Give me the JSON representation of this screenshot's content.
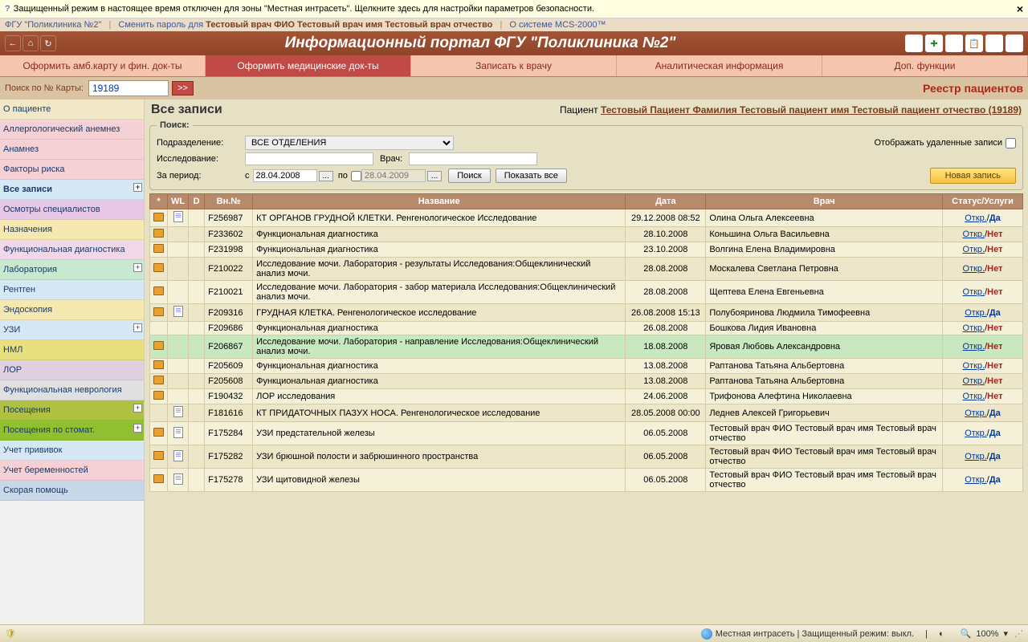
{
  "security": {
    "text": "Защищенный режим в настоящее время отключен для зоны \"Местная интрасеть\".  Щелкните здесь для настройки параметров безопасности.",
    "close": "×"
  },
  "toplinks": {
    "org": "ФГУ \"Поликлиника №2\"",
    "change_pw": "Сменить пароль для ",
    "user": "Тестовый врач ФИО Тестовый врач имя Тестовый врач отчество",
    "about": "О системе MCS-2000™"
  },
  "title": "Информационный портал ФГУ \"Поликлиника №2\"",
  "tabs": [
    "Оформить амб.карту и фин. док-ты",
    "Оформить медицинские док-ты",
    "Записать к врачу",
    "Аналитическая информация",
    "Доп. функции"
  ],
  "search": {
    "label": "Поиск по № Карты:",
    "value": "19189",
    "go": ">>",
    "registry": "Реестр пациентов"
  },
  "sidebar": [
    {
      "label": "О пациенте",
      "color": "#f2e8c8"
    },
    {
      "label": "Аллергологический анемнез",
      "color": "#f5d0d5"
    },
    {
      "label": "Анамнез",
      "color": "#f5d0d5"
    },
    {
      "label": "Факторы риска",
      "color": "#f5d0d5"
    },
    {
      "label": "Все записи",
      "color": "#d6e8f5",
      "plus": true,
      "active": true
    },
    {
      "label": "Осмотры специалистов",
      "color": "#e6c8e6"
    },
    {
      "label": "Назначения",
      "color": "#f5e8b0"
    },
    {
      "label": "Функциональная диагностика",
      "color": "#f0d8e8"
    },
    {
      "label": "Лаборатория",
      "color": "#c8e8d0",
      "plus": true
    },
    {
      "label": "Рентген",
      "color": "#d6e8f5"
    },
    {
      "label": "Эндоскопия",
      "color": "#f5e8b0"
    },
    {
      "label": "УЗИ",
      "color": "#d6e8f5",
      "plus": true
    },
    {
      "label": "НМЛ",
      "color": "#e8e080"
    },
    {
      "label": "ЛОР",
      "color": "#e0d0e0"
    },
    {
      "label": "Функциональная неврология",
      "color": "#e0e0e0"
    },
    {
      "label": "Посещения",
      "color": "#b0c040",
      "plus": true
    },
    {
      "label": "Посещения по стомат.",
      "color": "#90c030",
      "plus": true
    },
    {
      "label": "Учет прививок",
      "color": "#d6e8f5"
    },
    {
      "label": "Учет беременностей",
      "color": "#f5d0d5"
    },
    {
      "label": "Скорая помощь",
      "color": "#c8d8e8"
    }
  ],
  "main": {
    "heading": "Все записи",
    "patient_label": "Пациент ",
    "patient_link": "Тестовый Пациент Фамилия Тестовый пациент имя Тестовый пациент отчество (19189)"
  },
  "filters": {
    "legend": "Поиск:",
    "dept_label": "Подразделение:",
    "dept_value": "ВСЕ ОТДЕЛЕНИЯ",
    "study_label": "Исследование:",
    "doctor_label": "Врач:",
    "period_label": "За период:",
    "from": "с",
    "from_value": "28.04.2008",
    "to": "по",
    "to_ph": "28.04.2009",
    "search_btn": "Поиск",
    "showall_btn": "Показать все",
    "show_deleted": "Отображать удаленные записи",
    "new_btn": "Новая запись"
  },
  "columns": [
    "*",
    "WL",
    "D",
    "Вн.№",
    "Название",
    "Дата",
    "Врач",
    "Статус/Услуги"
  ],
  "status_open": "Откр.",
  "svc_yes": "Да",
  "svc_no": "Нет",
  "rows": [
    {
      "f": true,
      "d": true,
      "num": "F256987",
      "title": "КТ ОРГАНОВ ГРУДНОЙ КЛЕТКИ. Ренгенологическое Исследование",
      "date": "29.12.2008 08:52",
      "doctor": "Олина Ольга Алексеевна",
      "svc": true
    },
    {
      "f": true,
      "num": "F233602",
      "title": "Функциональная диагностика",
      "date": "28.10.2008",
      "doctor": "Коньшина Ольга Васильевна",
      "svc": false,
      "alt": true
    },
    {
      "f": true,
      "num": "F231998",
      "title": "Функциональная диагностика",
      "date": "23.10.2008",
      "doctor": "Волгина Елена Владимировна",
      "svc": false
    },
    {
      "f": true,
      "num": "F210022",
      "title": "Исследование мочи. Лаборатория - результаты Исследования:Общеклинический анализ мочи.",
      "date": "28.08.2008",
      "doctor": "Москалева Светлана Петровна",
      "svc": false,
      "alt": true
    },
    {
      "f": true,
      "num": "F210021",
      "title": "Исследование мочи. Лаборатория - забор материала Исследования:Общеклинический анализ мочи.",
      "date": "28.08.2008",
      "doctor": "Щептева Елена Евгеньевна",
      "svc": false
    },
    {
      "f": true,
      "d": true,
      "num": "F209316",
      "title": "ГРУДНАЯ КЛЕТКА. Ренгенологическое исследование",
      "date": "26.08.2008 15:13",
      "doctor": "Полубояринова Людмила Тимофеевна",
      "svc": true,
      "alt": true
    },
    {
      "num": "F209686",
      "title": "Функциональная диагностика",
      "date": "26.08.2008",
      "doctor": "Бошкова Лидия Ивановна",
      "svc": false
    },
    {
      "f": true,
      "num": "F206867",
      "title": "Исследование мочи. Лаборатория - направление Исследования:Общеклинический анализ мочи.",
      "date": "18.08.2008",
      "doctor": "Яровая Любовь Александровна",
      "svc": false,
      "hl": true
    },
    {
      "f": true,
      "num": "F205609",
      "title": "Функциональная диагностика",
      "date": "13.08.2008",
      "doctor": "Раптанова Татьяна Альбертовна",
      "svc": false
    },
    {
      "f": true,
      "num": "F205608",
      "title": "Функциональная диагностика",
      "date": "13.08.2008",
      "doctor": "Раптанова Татьяна Альбертовна",
      "svc": false,
      "alt": true
    },
    {
      "f": true,
      "num": "F190432",
      "title": "ЛОР исследования",
      "date": "24.06.2008",
      "doctor": "Трифонова Алефтина Николаевна",
      "svc": false
    },
    {
      "d": true,
      "num": "F181616",
      "title": "КТ ПРИДАТОЧНЫХ ПАЗУХ НОСА. Ренгенологическое исследование",
      "date": "28.05.2008 00:00",
      "doctor": "Леднев Алексей Григорьевич",
      "svc": true,
      "alt": true
    },
    {
      "f": true,
      "d": true,
      "num": "F175284",
      "title": "УЗИ предстательной железы",
      "date": "06.05.2008",
      "doctor": "Тестовый врач ФИО Тестовый врач имя Тестовый врач отчество",
      "svc": true
    },
    {
      "f": true,
      "d": true,
      "num": "F175282",
      "title": "УЗИ брюшной полости и забрюшинного пространства",
      "date": "06.05.2008",
      "doctor": "Тестовый врач ФИО Тестовый врач имя Тестовый врач отчество",
      "svc": true,
      "alt": true
    },
    {
      "f": true,
      "d": true,
      "num": "F175278",
      "title": "УЗИ щитовидной железы",
      "date": "06.05.2008",
      "doctor": "Тестовый врач ФИО Тестовый врач имя Тестовый врач отчество",
      "svc": true
    }
  ],
  "statusbar": {
    "zone": "Местная интрасеть | Защищенный режим: выкл.",
    "zoom": "100%"
  }
}
